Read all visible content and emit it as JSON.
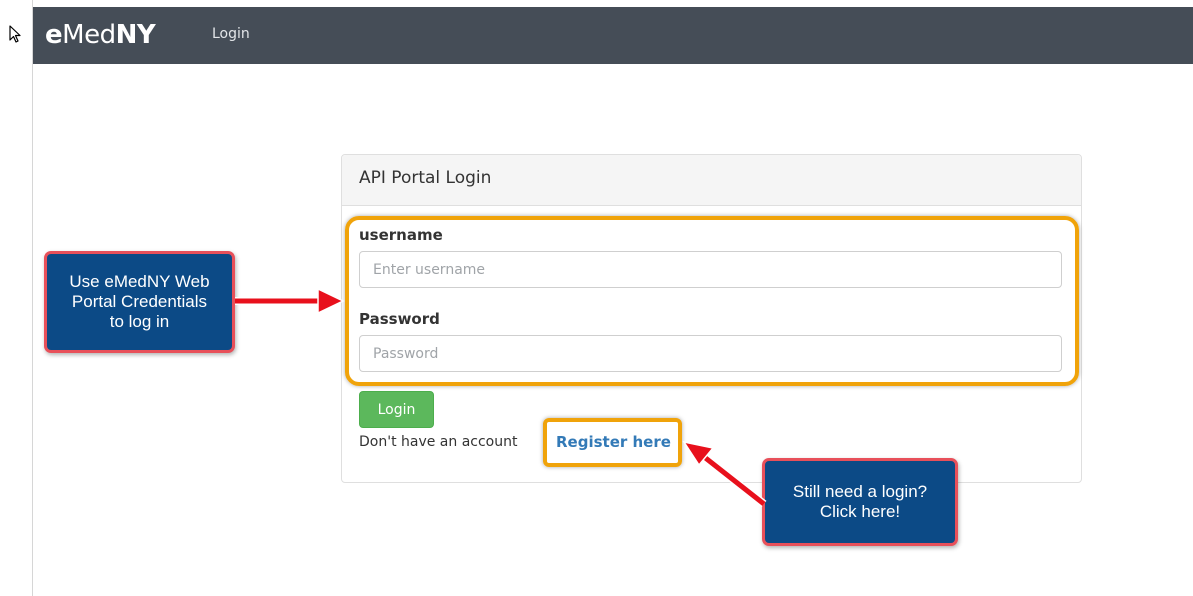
{
  "navbar": {
    "brand": {
      "e": "e",
      "med": "Med",
      "ny": "NY"
    },
    "links": [
      "Login"
    ]
  },
  "card": {
    "title": "API Portal Login",
    "username_label": "username",
    "username_placeholder": "Enter username",
    "password_label": "Password",
    "password_placeholder": "Password",
    "login_button": "Login",
    "no_account_text": "Don't have an account",
    "register_link": "Register here"
  },
  "annotations": {
    "callout_credentials": [
      "Use eMedNY Web",
      "Portal Credentials",
      "to log in"
    ],
    "callout_register": [
      "Still need a login?",
      "Click here!"
    ]
  },
  "colors": {
    "navbar_bg": "#454d57",
    "login_button_bg": "#5cb85c",
    "link_color": "#337ab7",
    "highlight_outline": "#f0a30a",
    "callout_bg": "#0c4a86",
    "callout_border": "#e8505a",
    "arrow_red": "#e8101c"
  },
  "icons": {
    "cursor": "mouse-pointer-icon"
  }
}
